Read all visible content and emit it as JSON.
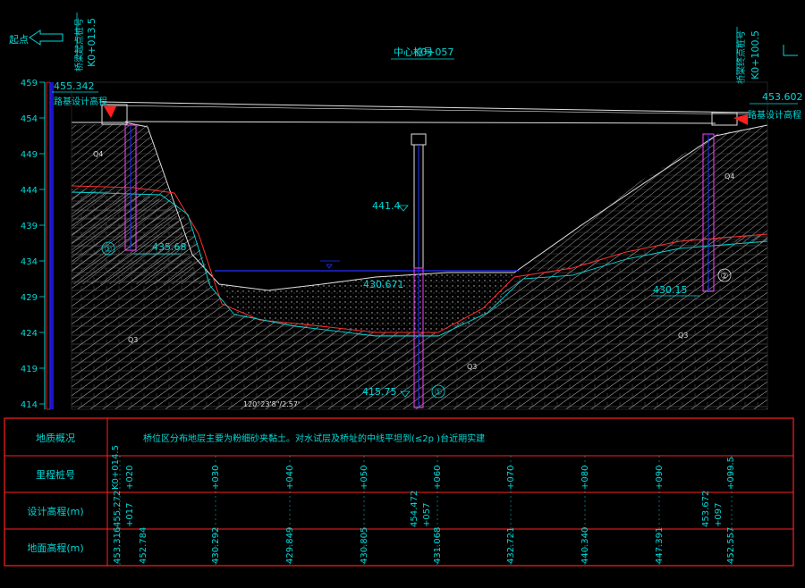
{
  "header": {
    "left_direction": "起点",
    "left_station_label": "桥梁起点桩号",
    "left_station": "K0+013.5",
    "center_label": "中心桩号",
    "center_station": "K0+057",
    "right_station_label": "桥梁终点桩号",
    "right_station": "K0+100.5"
  },
  "elevations": {
    "left_top": "455.342",
    "right_top": "453.602",
    "left_design_label": "路基设计高程",
    "right_design_label": "路基设计高程",
    "pier_top": "441.4",
    "pier_bottom": "415.75",
    "water_left": "430.671",
    "left_probe": "435.68",
    "right_probe": "430.15",
    "bottom_note": "120°23'8\"/2.57'"
  },
  "scale": {
    "ticks": [
      "459",
      "454",
      "449",
      "444",
      "439",
      "434",
      "429",
      "424",
      "419",
      "414"
    ]
  },
  "markers": [
    "①",
    "②",
    "①"
  ],
  "strata": [
    "Q4",
    "Q4",
    "Q3",
    "Q3",
    "Q3"
  ],
  "colors": {
    "frame": "#ff2020",
    "text": "#00d8d8",
    "ground": "#ff3030",
    "bedrock": "#ffffff",
    "water": "#2030ff",
    "pier": "#ff40ff"
  },
  "table": {
    "rows": [
      {
        "label": "地质概况",
        "note": "桥位区分布地层主要为粉细砂夹黏土。对水试层及桥址的中线平坦到(≤2p )台近期实建"
      },
      {
        "label": "里程桩号",
        "values": [
          "K0+014.5",
          "+020",
          "+030",
          "+040",
          "+050",
          "+060",
          "+070",
          "+080",
          "+090",
          "+099.5"
        ]
      },
      {
        "label": "设计高程(m)",
        "values": [
          "455.272",
          "+017",
          "454.472",
          "+057",
          "453.672",
          "+097"
        ]
      },
      {
        "label": "地面高程(m)",
        "values": [
          "453.316",
          "452.784",
          "430.292",
          "429.849",
          "430.805",
          "431.068",
          "432.721",
          "440.340",
          "447.391",
          "452.557"
        ]
      }
    ]
  }
}
